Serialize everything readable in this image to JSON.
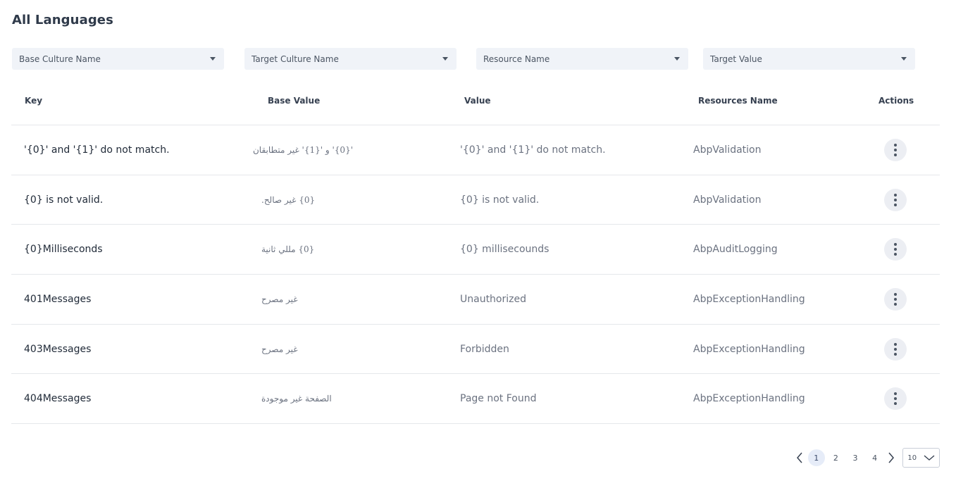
{
  "page": {
    "title": "All Languages"
  },
  "filters": [
    {
      "placeholder": "Base Culture Name"
    },
    {
      "placeholder": "Target Culture Name"
    },
    {
      "placeholder": "Resource Name"
    },
    {
      "placeholder": "Target Value"
    }
  ],
  "table": {
    "headers": {
      "key": "Key",
      "base_value": "Base Value",
      "value": "Value",
      "resources_name": "Resources Name",
      "actions": "Actions"
    },
    "rows": [
      {
        "key": "'{0}' and '{1}' do not match.",
        "base_value": "'{0}' و '{1}' غير متطابقان",
        "value": "'{0}' and '{1}' do not match.",
        "resource": "AbpValidation"
      },
      {
        "key": "{0} is not valid.",
        "base_value": "{0} غير صالح.",
        "value": "{0} is not valid.",
        "resource": "AbpValidation"
      },
      {
        "key": "{0}Milliseconds",
        "base_value": "{0} مللي ثانية",
        "value": "{0}  millisecounds",
        "resource": "AbpAuditLogging"
      },
      {
        "key": "401Messages",
        "base_value": "غير مصرح",
        "value": "Unauthorized",
        "resource": "AbpExceptionHandling"
      },
      {
        "key": "403Messages",
        "base_value": "غير مصرح",
        "value": "Forbidden",
        "resource": "AbpExceptionHandling"
      },
      {
        "key": "404Messages",
        "base_value": "الصفحة غير موجودة",
        "value": "Page not Found",
        "resource": "AbpExceptionHandling"
      }
    ]
  },
  "pagination": {
    "pages": [
      "1",
      "2",
      "3",
      "4"
    ],
    "current_page": "1",
    "page_size": "10",
    "active_color": "#e6ecf8"
  }
}
